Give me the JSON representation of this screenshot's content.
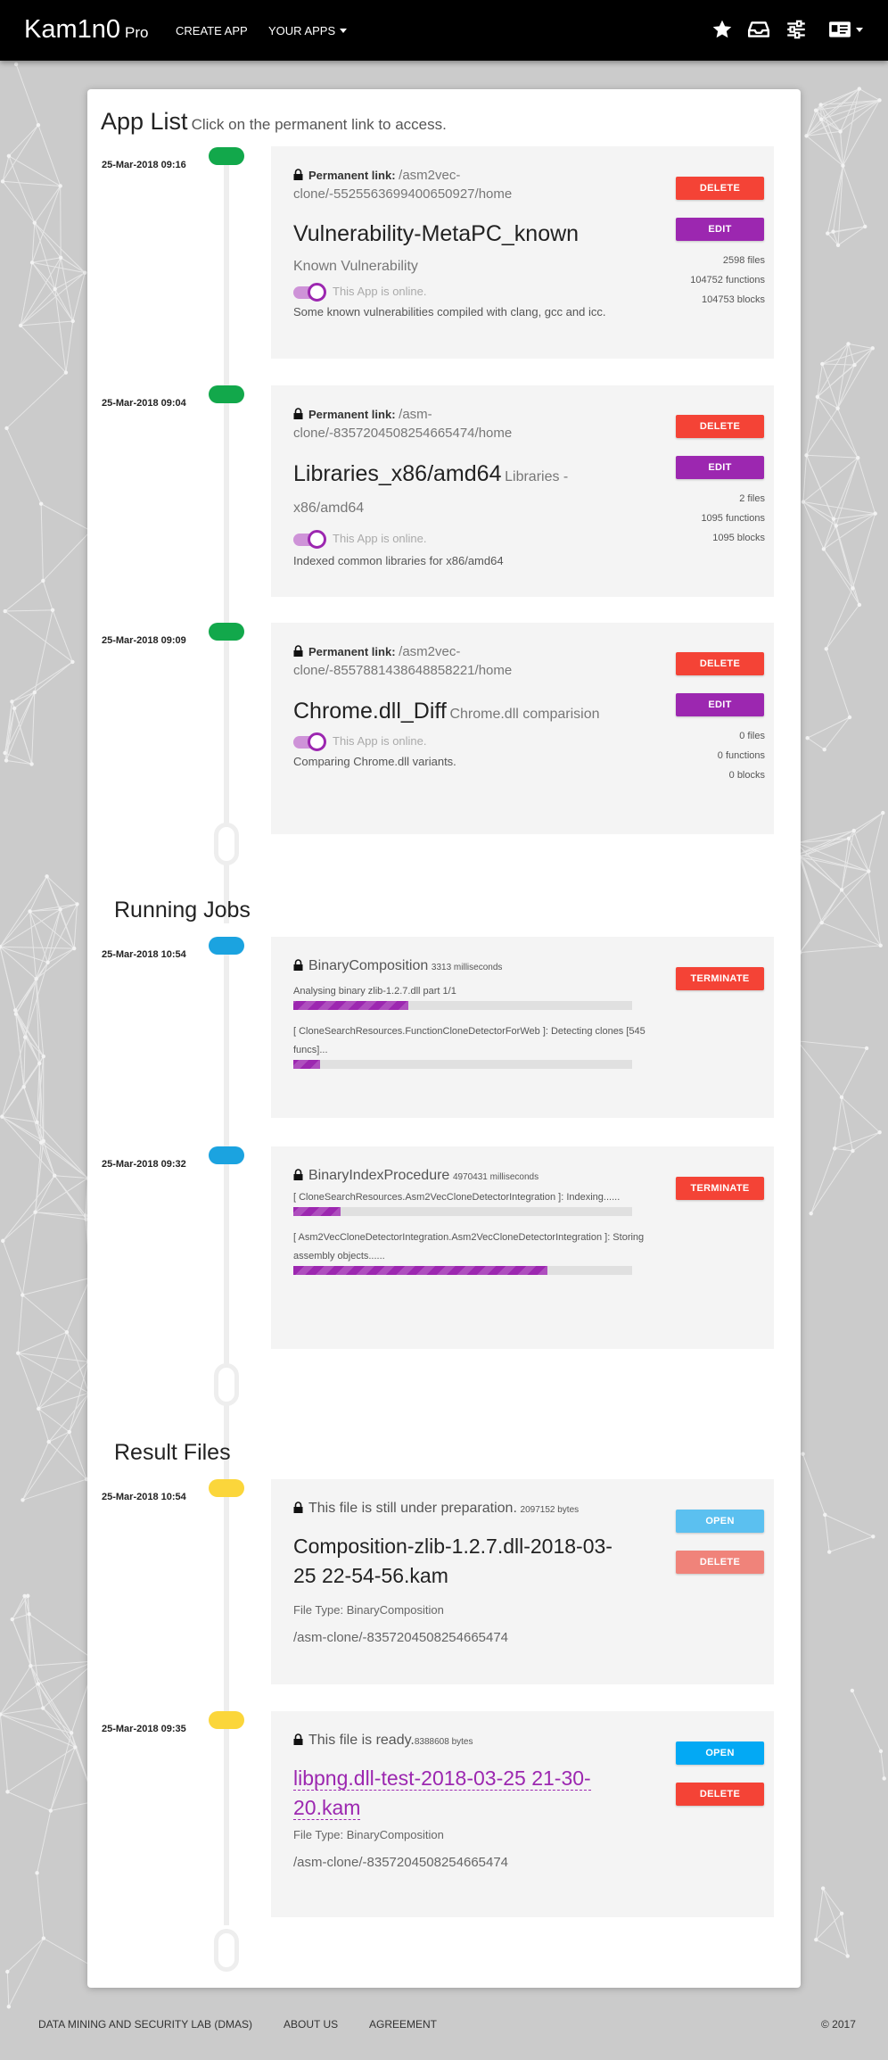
{
  "navbar": {
    "brand": "Kam1n0",
    "brand_suffix": "Pro",
    "create_app": "CREATE APP",
    "your_apps": "YOUR APPS",
    "icons": [
      "star-icon",
      "inbox-icon",
      "sliders-icon",
      "id-card-icon"
    ]
  },
  "app_list": {
    "title": "App List",
    "subtitle": "Click on the permanent link to access.",
    "permanent_label": "Permanent link:",
    "online_text": "This App is online.",
    "delete_label": "DELETE",
    "edit_label": "EDIT",
    "items": [
      {
        "date": "25-Mar-2018 09:16",
        "link": "/asm2vec-clone/-5525563699400650927/home",
        "name": "Vulnerability-MetaPC_known",
        "desc": "Known Vulnerability",
        "comment": "Some known vulnerabilities compiled with clang, gcc and icc.",
        "files": "2598 files",
        "functions": "104752 functions",
        "blocks": "104753 blocks"
      },
      {
        "date": "25-Mar-2018 09:04",
        "link": "/asm-clone/-8357204508254665474/home",
        "name": "Libraries_x86/amd64",
        "desc": "Libraries - x86/amd64",
        "comment": "Indexed common libraries for x86/amd64",
        "files": "2 files",
        "functions": "1095 functions",
        "blocks": "1095 blocks"
      },
      {
        "date": "25-Mar-2018 09:09",
        "link": "/asm2vec-clone/-8557881438648858221/home",
        "name": "Chrome.dll_Diff",
        "desc": "Chrome.dll comparision",
        "comment": "Comparing Chrome.dll variants.",
        "files": "0 files",
        "functions": "0 functions",
        "blocks": "0 blocks"
      }
    ]
  },
  "running_jobs": {
    "title": "Running Jobs",
    "terminate_label": "TERMINATE",
    "items": [
      {
        "date": "25-Mar-2018 10:54",
        "name": "BinaryComposition",
        "duration": "3313 milliseconds",
        "tasks": [
          {
            "message": "Analysing binary zlib-1.2.7.dll part 1/1",
            "progress": 0.34
          },
          {
            "message": "[ CloneSearchResources.FunctionCloneDetectorForWeb ]: Detecting clones [545 funcs]...",
            "progress": 0.08
          }
        ]
      },
      {
        "date": "25-Mar-2018 09:32",
        "name": "BinaryIndexProcedure",
        "duration": "4970431 milliseconds",
        "tasks": [
          {
            "message": "[ CloneSearchResources.Asm2VecCloneDetectorIntegration ]: Indexing......",
            "progress": 0.14
          },
          {
            "message": "[ Asm2VecCloneDetectorIntegration.Asm2VecCloneDetectorIntegration ]: Storing assembly objects......",
            "progress": 0.75
          }
        ]
      }
    ]
  },
  "result_files": {
    "title": "Result Files",
    "open_label": "OPEN",
    "delete_label": "DELETE",
    "items": [
      {
        "date": "25-Mar-2018 10:54",
        "status": "This file is still under preparation.",
        "size": "2097152 bytes",
        "name": "Composition-zlib-1.2.7.dll-2018-03-25 22-54-56.kam",
        "type": "File Type: BinaryComposition",
        "path": "/asm-clone/-8357204508254665474"
      },
      {
        "date": "25-Mar-2018 09:35",
        "status": "This file is ready.",
        "size": "8388608 bytes",
        "name": "libpng.dll-test-2018-03-25 21-30-20.kam",
        "type": "File Type: BinaryComposition",
        "path": "/asm-clone/-8357204508254665474"
      }
    ]
  },
  "footer": {
    "lab": "DATA MINING AND SECURITY LAB (DMAS)",
    "about": "ABOUT US",
    "agreement": "AGREEMENT",
    "copyright": "© 2017"
  },
  "colors": {
    "green": "#12a84b",
    "blue": "#1ba3e0",
    "yellow": "#fbd63b",
    "purple": "#9c27b0",
    "red": "#f44336"
  }
}
